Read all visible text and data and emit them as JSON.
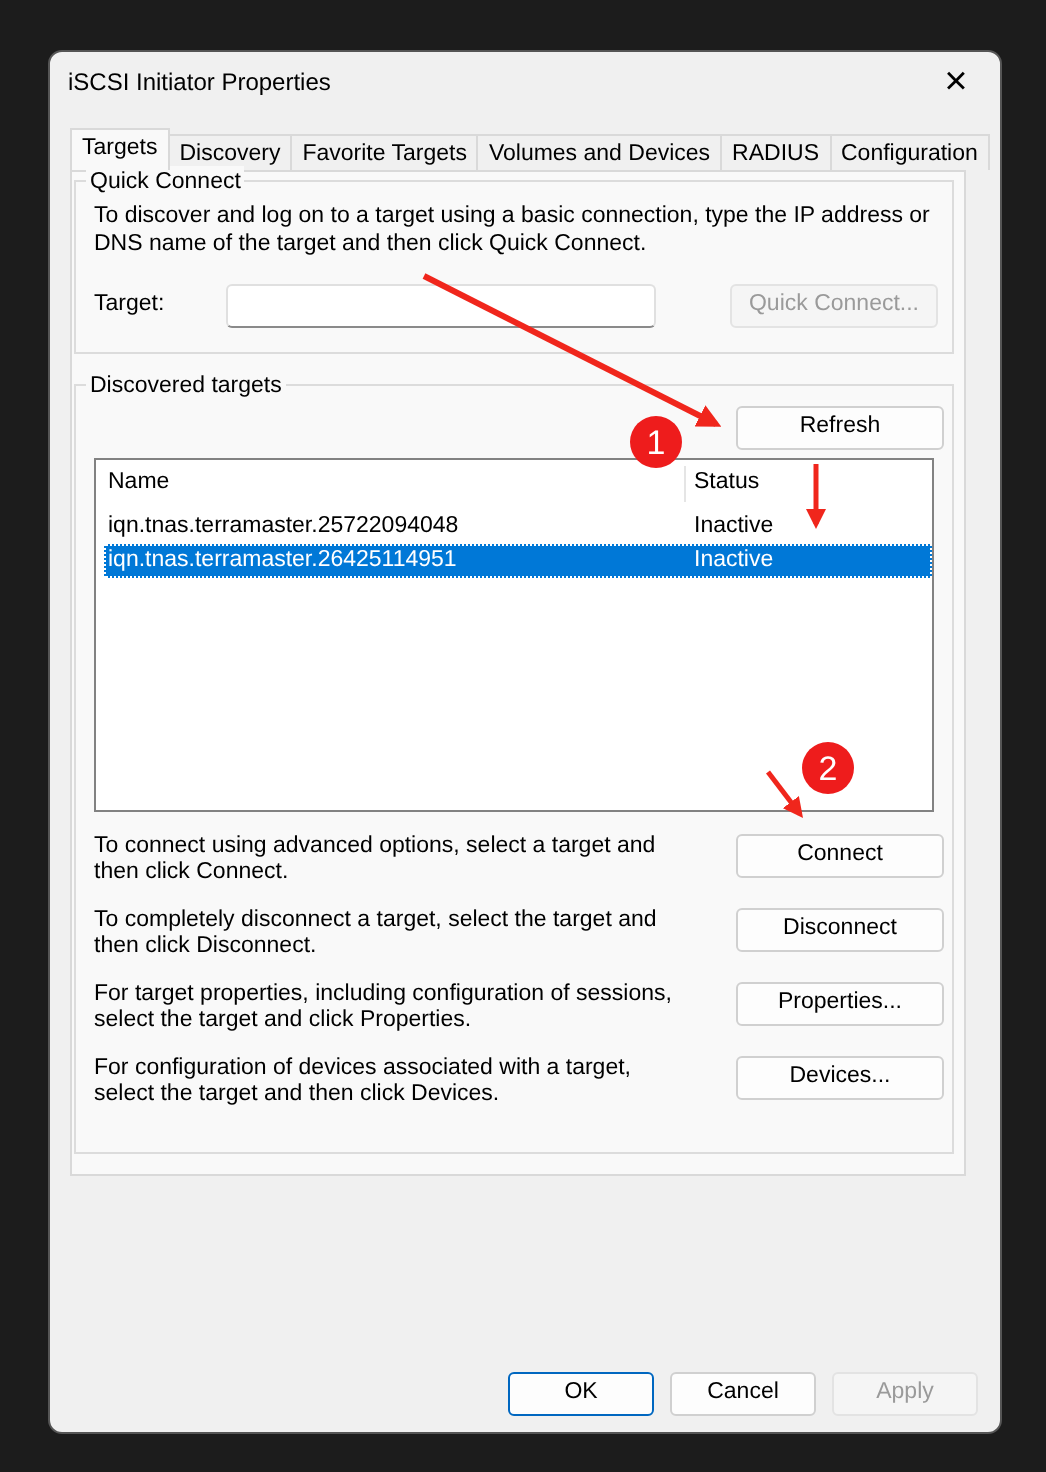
{
  "window": {
    "title": "iSCSI Initiator Properties",
    "close": "×"
  },
  "tabs": [
    {
      "label": "Targets",
      "selected": true
    },
    {
      "label": "Discovery",
      "selected": false
    },
    {
      "label": "Favorite Targets",
      "selected": false
    },
    {
      "label": "Volumes and Devices",
      "selected": false
    },
    {
      "label": "RADIUS",
      "selected": false
    },
    {
      "label": "Configuration",
      "selected": false
    }
  ],
  "quick_connect": {
    "title": "Quick Connect",
    "description": "To discover and log on to a target using a basic connection, type the IP address or DNS name of the target and then click Quick Connect.",
    "target_label": "Target:",
    "button": {
      "label": "Quick Connect...",
      "disabled": true
    }
  },
  "discovered_targets": {
    "title": "Discovered targets",
    "refresh_button": "Refresh",
    "table": {
      "columns": [
        "Name",
        "Status"
      ],
      "rows": [
        {
          "name": "iqn.tnas.terramaster.25722094048",
          "status": "Inactive",
          "selected": false
        },
        {
          "name": "iqn.tnas.terramaster.26425114951",
          "status": "Inactive",
          "selected": true
        }
      ]
    },
    "actions": [
      {
        "description": "To connect using advanced options, select a target and then click Connect.",
        "button": "Connect"
      },
      {
        "description": "To completely disconnect a target, select the target and then click Disconnect.",
        "button": "Disconnect"
      },
      {
        "description": "For target properties, including configuration of sessions, select the target and click Properties.",
        "button": "Properties..."
      },
      {
        "description": "For configuration of devices associated with a target, select the target and then click Devices.",
        "button": "Devices..."
      }
    ]
  },
  "footer_buttons": [
    {
      "label": "OK",
      "default": true,
      "disabled": false
    },
    {
      "label": "Cancel",
      "default": false,
      "disabled": false
    },
    {
      "label": "Apply",
      "default": false,
      "disabled": true
    }
  ],
  "annotations": [
    {
      "label": "1"
    },
    {
      "label": "2"
    }
  ]
}
